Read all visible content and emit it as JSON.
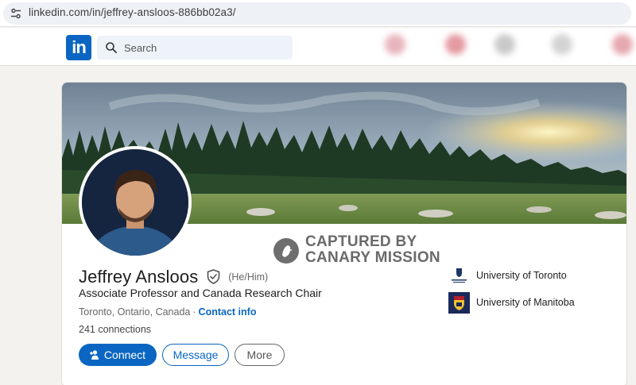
{
  "browser": {
    "url": "linkedin.com/in/jeffrey-ansloos-886bb02a3/"
  },
  "nav": {
    "logo_text": "in",
    "search_placeholder": "Search"
  },
  "watermark": {
    "line1": "CAPTURED BY",
    "line2": "CANARY MISSION"
  },
  "profile": {
    "name": "Jeffrey Ansloos",
    "pronouns": "(He/Him)",
    "headline": "Associate Professor and Canada Research Chair",
    "location": "Toronto, Ontario, Canada",
    "separator": "·",
    "contact_info": "Contact info",
    "connections": "241 connections"
  },
  "actions": {
    "connect_label": "Connect",
    "message_label": "Message",
    "more_label": "More"
  },
  "education": [
    {
      "name": "University of Toronto"
    },
    {
      "name": "University of Manitoba"
    }
  ],
  "colors": {
    "linkedin_blue": "#0a66c2",
    "page_bg": "#f4f2ee"
  }
}
